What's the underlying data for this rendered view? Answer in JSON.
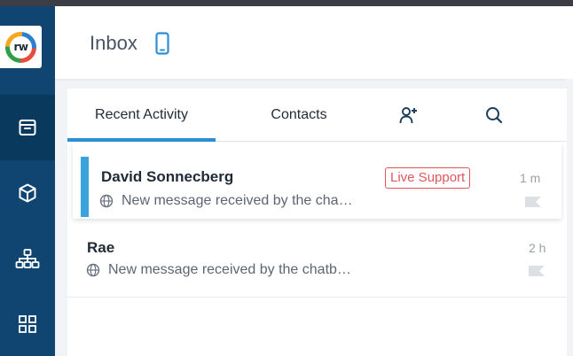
{
  "brand": {
    "logo_text": "rw"
  },
  "sidebar": {
    "items": [
      {
        "icon": "archive-icon",
        "active": true
      },
      {
        "icon": "cube-icon",
        "active": false
      },
      {
        "icon": "sitemap-icon",
        "active": false
      },
      {
        "icon": "apps-grid-icon",
        "active": false
      }
    ]
  },
  "header": {
    "title": "Inbox",
    "icon": "mobile-phone-icon"
  },
  "tabs": {
    "recent": "Recent Activity",
    "contacts": "Contacts",
    "add_contact_icon": "add-user-icon",
    "search_icon": "search-icon"
  },
  "conversations": [
    {
      "name": "David Sonnecberg",
      "badge": "Live Support",
      "message": "New message received by the cha…",
      "time": "1 m",
      "channel_icon": "globe-icon",
      "flag_icon": "flag-icon",
      "selected": true
    },
    {
      "name": "Rae",
      "message": "New message received by the chatb…",
      "time": "2 h",
      "channel_icon": "globe-icon",
      "flag_icon": "flag-icon",
      "selected": false
    }
  ],
  "colors": {
    "sidebar": "#0f4570",
    "accent": "#2b8fd6",
    "badge": "#e0565c"
  }
}
